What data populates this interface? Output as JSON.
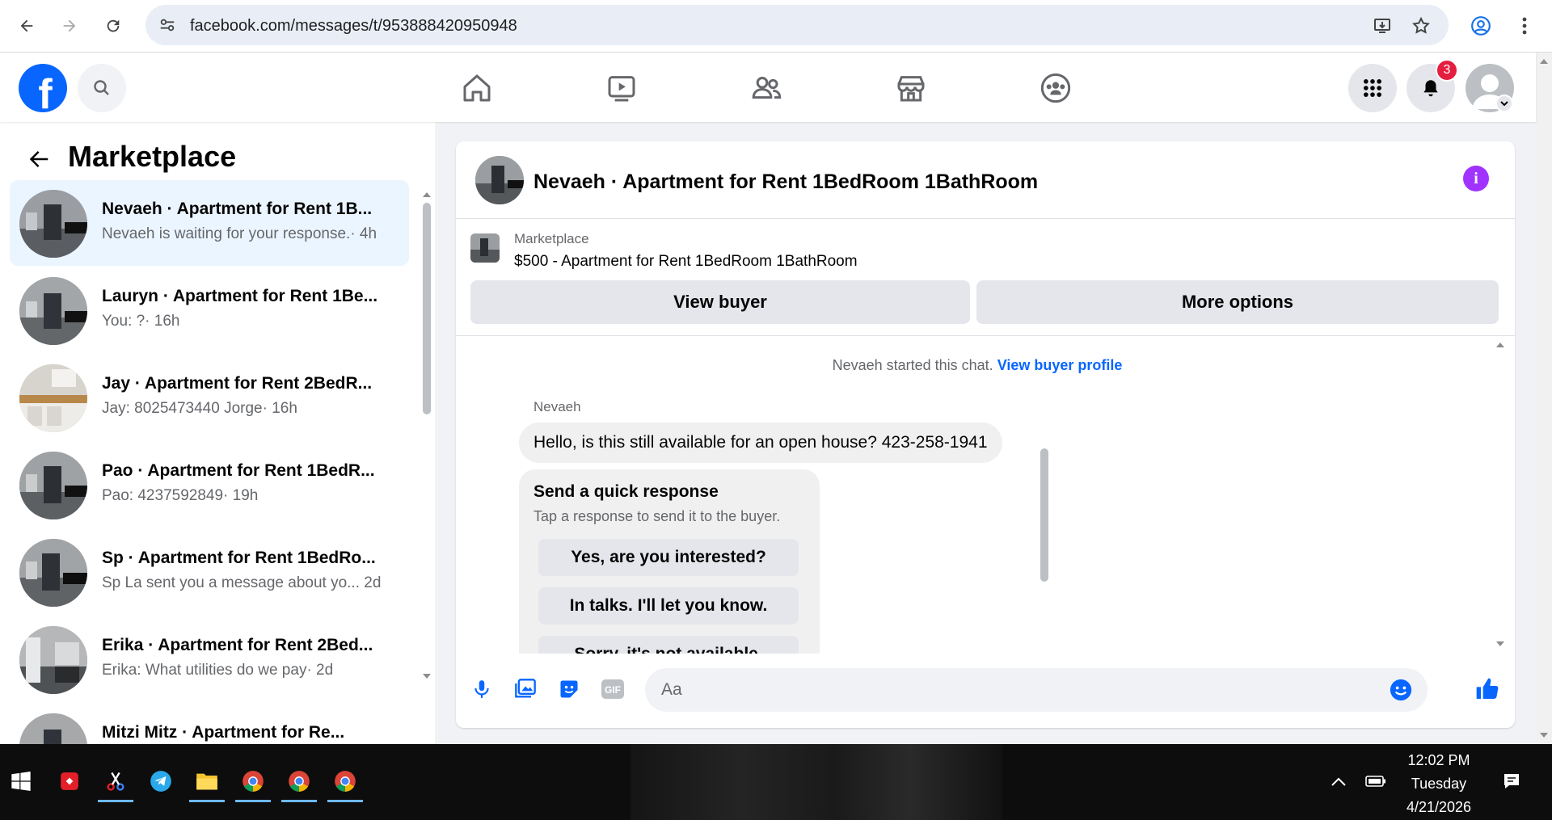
{
  "browser": {
    "url": "facebook.com/messages/t/953888420950948"
  },
  "fb_nav": {
    "notifications_count": "3",
    "logo_letter": "f"
  },
  "left_panel": {
    "title": "Marketplace",
    "conversations": [
      {
        "title": "Nevaeh · Apartment for Rent 1B...",
        "subtitle": "Nevaeh is waiting for your response.· 4h",
        "active": true
      },
      {
        "title": "Lauryn · Apartment for Rent 1Be...",
        "subtitle": "You: ?· 16h",
        "active": false
      },
      {
        "title": "Jay · Apartment for Rent 2BedR...",
        "subtitle": "Jay: 8025473440 Jorge· 16h",
        "active": false
      },
      {
        "title": "Pao · Apartment for Rent 1BedR...",
        "subtitle": "Pao: 4237592849· 19h",
        "active": false
      },
      {
        "title": "Sp · Apartment for Rent 1BedRo...",
        "subtitle": "Sp La sent you a message about yo...  2d",
        "active": false
      },
      {
        "title": "Erika · Apartment for Rent 2Bed...",
        "subtitle": "Erika: What utilities do we pay· 2d",
        "active": false
      },
      {
        "title": "Mitzi Mitz · Apartment for Re...",
        "subtitle": "",
        "active": false
      }
    ]
  },
  "chat": {
    "title": "Nevaeh · Apartment for Rent 1BedRoom 1BathRoom",
    "marketplace_label": "Marketplace",
    "listing": "$500 - Apartment for Rent 1BedRoom 1BathRoom",
    "view_buyer": "View buyer",
    "more_options": "More options",
    "started_text": "Nevaeh started this chat.",
    "view_buyer_profile": "View buyer profile",
    "sender": "Nevaeh",
    "message": "Hello, is this still available for an open house? 423-258-1941",
    "quick_title": "Send a quick response",
    "quick_subtitle": "Tap a response to send it to the buyer.",
    "quick_responses": [
      "Yes, are you interested?",
      "In talks. I'll let you know.",
      "Sorry, it's not available."
    ],
    "composer_placeholder": "Aa"
  },
  "taskbar": {
    "time": "12:02 PM",
    "day": "Tuesday",
    "date": "4/21/2026"
  },
  "colors": {
    "fb_blue": "#0866ff",
    "active_bg": "#ebf5ff",
    "badge_red": "#e41e3f",
    "info_purple": "#a033ff"
  }
}
